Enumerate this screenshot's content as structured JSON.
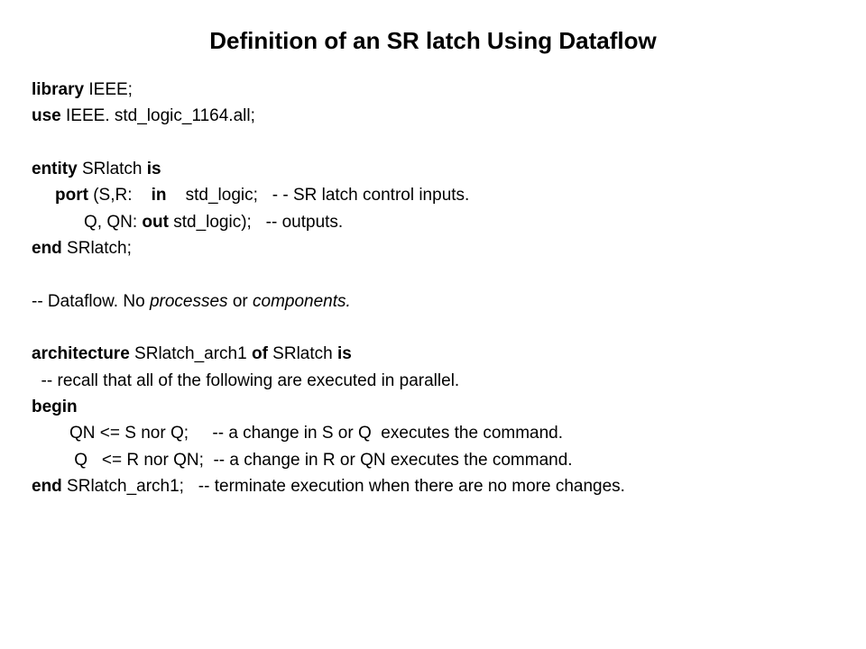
{
  "title": "Definition of an SR latch Using Dataflow",
  "l1a": "library",
  "l1b": " IEEE;",
  "l2a": "use",
  "l2b": " IEEE. std_logic_1164.all;",
  "l3a": "entity",
  "l3b": " SRlatch ",
  "l3c": "is",
  "l4a": "port ",
  "l4b": "(S,R:    ",
  "l4c": "in",
  "l4d": "    std_logic;   - - SR latch control inputs.",
  "l5a": "Q, QN: ",
  "l5b": "out ",
  "l5c": "std_logic);   -- outputs.",
  "l6a": "end",
  "l6b": " SRlatch;",
  "l7a": "-- Dataflow. No ",
  "l7b": "processes",
  "l7c": " or ",
  "l7d": "components.",
  "l8a": "architecture",
  "l8b": " SRlatch_arch1 ",
  "l8c": "of",
  "l8d": " SRlatch ",
  "l8e": "is",
  "l9": "  -- recall that all of the following are executed in parallel.",
  "l10": "begin",
  "l11": "QN <= S nor Q;     -- a change in S or Q  executes the command.",
  "l12": " Q   <= R nor QN;  -- a change in R or QN executes the command.",
  "l13a": "end",
  "l13b": " SRlatch_arch1;   -- terminate execution when there are no more changes."
}
